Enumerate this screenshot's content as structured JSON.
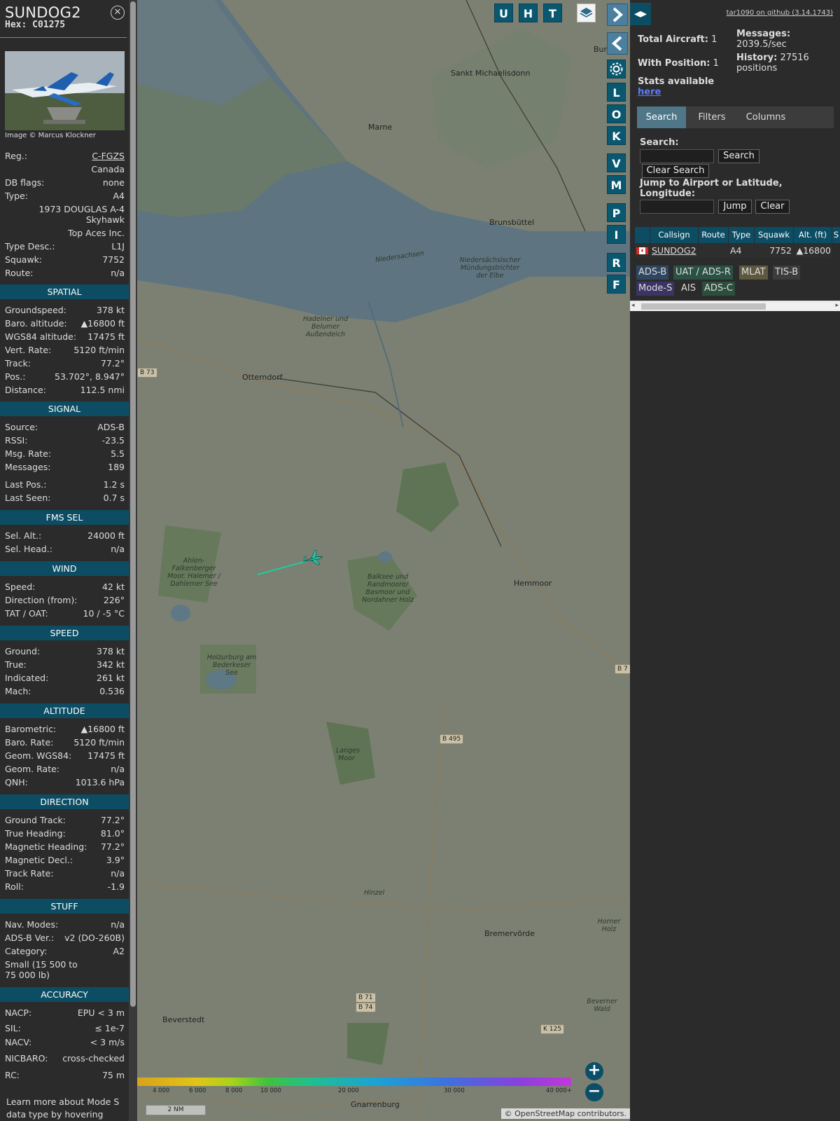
{
  "aircraft": {
    "callsign": "SUNDOG2",
    "hex": "Hex: C01275",
    "photo_credit": "Image © Marcus Klockner",
    "reg_label": "Reg.:",
    "reg": "C-FGZS",
    "country": "Canada",
    "dbflags_label": "DB flags:",
    "dbflags": "none",
    "type_label": "Type:",
    "type": "A4",
    "type_full_1": "1973 DOUGLAS A-4",
    "type_full_2": "Skyhawk",
    "operator": "Top Aces Inc.",
    "typedesc_label": "Type Desc.:",
    "typedesc": "L1J",
    "squawk_label": "Squawk:",
    "squawk": "7752",
    "route_label": "Route:",
    "route": "n/a"
  },
  "sections": {
    "spatial": {
      "title": "SPATIAL",
      "rows": [
        {
          "k": "Groundspeed:",
          "v": "378 kt"
        },
        {
          "k": "Baro. altitude:",
          "v": "▲16800 ft"
        },
        {
          "k": "WGS84 altitude:",
          "v": "17475 ft"
        },
        {
          "k": "Vert. Rate:",
          "v": "5120 ft/min"
        },
        {
          "k": "Track:",
          "v": "77.2°"
        },
        {
          "k": "Pos.:",
          "v": "53.702°, 8.947°"
        },
        {
          "k": "Distance:",
          "v": "112.5 nmi"
        }
      ]
    },
    "signal": {
      "title": "SIGNAL",
      "rows": [
        {
          "k": "Source:",
          "v": "ADS-B"
        },
        {
          "k": "RSSI:",
          "v": "-23.5"
        },
        {
          "k": "Msg. Rate:",
          "v": "5.5"
        },
        {
          "k": "Messages:",
          "v": "189"
        },
        {
          "k": "Last Pos.:",
          "v": "1.2 s"
        },
        {
          "k": "Last Seen:",
          "v": "0.7 s"
        }
      ]
    },
    "fms": {
      "title": "FMS SEL",
      "rows": [
        {
          "k": "Sel. Alt.:",
          "v": "24000 ft"
        },
        {
          "k": "Sel. Head.:",
          "v": "n/a"
        }
      ]
    },
    "wind": {
      "title": "WIND",
      "rows": [
        {
          "k": "Speed:",
          "v": "42 kt"
        },
        {
          "k": "Direction (from):",
          "v": "226°"
        },
        {
          "k": "TAT / OAT:",
          "v": "10 / -5 °C"
        }
      ]
    },
    "speed": {
      "title": "SPEED",
      "rows": [
        {
          "k": "Ground:",
          "v": "378 kt"
        },
        {
          "k": "True:",
          "v": "342 kt"
        },
        {
          "k": "Indicated:",
          "v": "261 kt"
        },
        {
          "k": "Mach:",
          "v": "0.536"
        }
      ]
    },
    "altitude": {
      "title": "ALTITUDE",
      "rows": [
        {
          "k": "Barometric:",
          "v": "▲16800 ft"
        },
        {
          "k": "Baro. Rate:",
          "v": "5120 ft/min"
        },
        {
          "k": "Geom. WGS84:",
          "v": "17475 ft"
        },
        {
          "k": "Geom. Rate:",
          "v": "n/a"
        },
        {
          "k": "QNH:",
          "v": "1013.6 hPa"
        }
      ]
    },
    "direction": {
      "title": "DIRECTION",
      "rows": [
        {
          "k": "Ground Track:",
          "v": "77.2°"
        },
        {
          "k": "True Heading:",
          "v": "81.0°"
        },
        {
          "k": "Magnetic Heading:",
          "v": "77.2°"
        },
        {
          "k": "Magnetic Decl.:",
          "v": "3.9°"
        },
        {
          "k": "Track Rate:",
          "v": "n/a"
        },
        {
          "k": "Roll:",
          "v": "-1.9"
        }
      ]
    },
    "stuff": {
      "title": "STUFF",
      "rows": [
        {
          "k": "Nav. Modes:",
          "v": "n/a"
        },
        {
          "k": "ADS-B Ver.:",
          "v": "v2 (DO-260B)"
        },
        {
          "k": "Category:",
          "v": "A2"
        }
      ],
      "category_desc_1": "Small (15 500 to",
      "category_desc_2": "75 000 lb)"
    },
    "accuracy": {
      "title": "ACCURACY",
      "rows": [
        {
          "k": "NACP:",
          "v": "EPU < 3 m"
        },
        {
          "k": "SIL:",
          "v": "≤ 1e-7"
        },
        {
          "k": "NACV:",
          "v": "< 3 m/s"
        },
        {
          "k": "NICBARO:",
          "v": "cross-checked"
        },
        {
          "k": "RC:",
          "v": "75 m"
        }
      ],
      "footer_1": "Learn more about Mode S",
      "footer_2": "data type by hovering over"
    }
  },
  "map": {
    "buttons_top": [
      "U",
      "H",
      "T"
    ],
    "buttons_side": [
      "L",
      "O",
      "K",
      "V",
      "M",
      "P",
      "I",
      "R",
      "F"
    ],
    "places": [
      {
        "name": "Sankt Michaelisdonn"
      },
      {
        "name": "Marne"
      },
      {
        "name": "Brunsbüttel"
      },
      {
        "name": "Otterndorf"
      },
      {
        "name": "Hemmoor"
      },
      {
        "name": "Bremervörde"
      },
      {
        "name": "Beverstedt"
      },
      {
        "name": "Gnarrenburg"
      },
      {
        "name": "Burg"
      }
    ],
    "areas": [
      "Niedersächsischer Mündungstrichter der Elbe",
      "Hadelner und Belumer Außendeich",
      "Ahlen-Falkenberger Moor, Halemer / Dahlemer See",
      "Balksee und Randmoore/ Basmoor und Nordahner Holz",
      "Holzurburg am Bederkeser See",
      "Langes Moor",
      "Hinzel",
      "Horner Holz",
      "Beverner Wald",
      "Niedersachsen"
    ],
    "roads": [
      "B 73",
      "B 495",
      "B 71",
      "B 74",
      "K 125",
      "B 7"
    ],
    "altitude_scale": [
      "4 000",
      "6 000",
      "8 000",
      "10 000",
      "20 000",
      "30 000",
      "40 000+"
    ],
    "scale": "2 NM",
    "attribution_prefix": "© ",
    "attribution_link": "OpenStreetMap",
    "attribution_suffix": " contributors."
  },
  "sidebar": {
    "github_link": "tar1090 on github (3.14.1743)",
    "total_label": "Total Aircraft:",
    "total": "1",
    "withpos_label": "With Position:",
    "withpos": "1",
    "messages_label": "Messages:",
    "messages": "2039.5/sec",
    "history_label": "History: 27516",
    "history_unit": "positions",
    "stats_text": "Stats available",
    "stats_link": "here",
    "tabs": [
      "Search",
      "Filters",
      "Columns"
    ],
    "search_label": "Search:",
    "search_button": "Search",
    "clear_search_button": "Clear Search",
    "jump_label_1": "Jump to Airport or Latitude,",
    "jump_label_2": "Longitude:",
    "jump_button": "Jump",
    "clear_button": "Clear",
    "table_headers": [
      "Callsign",
      "Route",
      "Type",
      "Squawk",
      "Alt. (ft)",
      "S"
    ],
    "table_row": {
      "callsign": "SUNDOG2",
      "route": "",
      "type": "A4",
      "squawk": "7752",
      "alt": "▲16800"
    },
    "source_chips": [
      "ADS-B",
      "UAT / ADS-R",
      "MLAT",
      "TIS-B",
      "Mode-S",
      "AIS",
      "ADS-C"
    ]
  }
}
